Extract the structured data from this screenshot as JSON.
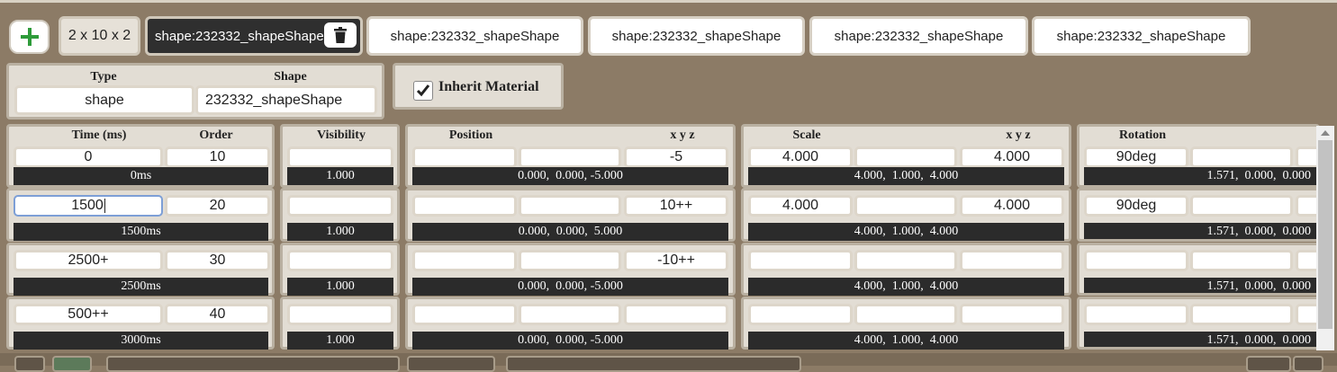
{
  "toolbar": {
    "add_icon": "plus-icon",
    "grid_size": "2 x 10 x 2",
    "active_tab": "shape:232332_shapeShape",
    "trash_icon": "trash-icon",
    "tabs": [
      "shape:232332_shapeShape",
      "shape:232332_shapeShape",
      "shape:232332_shapeShape",
      "shape:232332_shapeShape"
    ]
  },
  "info": {
    "type_label": "Type",
    "shape_label": "Shape",
    "type_value": "shape",
    "shape_value": "232332_shapeShape",
    "inherit_label": "Inherit Material",
    "inherit_checked": true
  },
  "headers": {
    "time": "Time (ms)",
    "order": "Order",
    "visibility": "Visibility",
    "position": "Position",
    "position_xyz": "x y z",
    "scale": "Scale",
    "scale_xyz": "x y z",
    "rotation": "Rotation"
  },
  "rows": [
    {
      "time": "0",
      "order": "10",
      "time_bar": "0ms",
      "visibility": "",
      "vis_bar": "1.000",
      "pos_x": "",
      "pos_y": "",
      "pos_z": "-5",
      "pos_bar": "0.000,  0.000, -5.000",
      "scale_x": "4.000",
      "scale_y": "",
      "scale_z": "4.000",
      "scale_bar": "4.000,  1.000,  4.000",
      "rot_x": "90deg",
      "rot_y": "",
      "rot_bar": "1.571,  0.000,  0.000"
    },
    {
      "time": "1500",
      "order": "20",
      "time_bar": "1500ms",
      "visibility": "",
      "vis_bar": "1.000",
      "pos_x": "",
      "pos_y": "",
      "pos_z": "10++",
      "pos_bar": "0.000,  0.000,  5.000",
      "scale_x": "4.000",
      "scale_y": "",
      "scale_z": "4.000",
      "scale_bar": "4.000,  1.000,  4.000",
      "rot_x": "90deg",
      "rot_y": "",
      "rot_bar": "1.571,  0.000,  0.000"
    },
    {
      "time": "2500+",
      "order": "30",
      "time_bar": "2500ms",
      "visibility": "",
      "vis_bar": "1.000",
      "pos_x": "",
      "pos_y": "",
      "pos_z": "-10++",
      "pos_bar": "0.000,  0.000, -5.000",
      "scale_x": "",
      "scale_y": "",
      "scale_z": "",
      "scale_bar": "4.000,  1.000,  4.000",
      "rot_x": "",
      "rot_y": "",
      "rot_bar": "1.571,  0.000,  0.000"
    },
    {
      "time": "500++",
      "order": "40",
      "time_bar": "3000ms",
      "visibility": "",
      "vis_bar": "1.000",
      "pos_x": "",
      "pos_y": "",
      "pos_z": "",
      "pos_bar": "0.000,  0.000, -5.000",
      "scale_x": "",
      "scale_y": "",
      "scale_z": "",
      "scale_bar": "4.000,  1.000,  4.000",
      "rot_x": "",
      "rot_y": "",
      "rot_bar": "1.571,  0.000,  0.000"
    }
  ],
  "colors": {
    "background": "#8c7b66",
    "panel": "#e2ddd4",
    "dark_bar": "#2b2b2b",
    "accent_green": "#2e9b3a"
  }
}
